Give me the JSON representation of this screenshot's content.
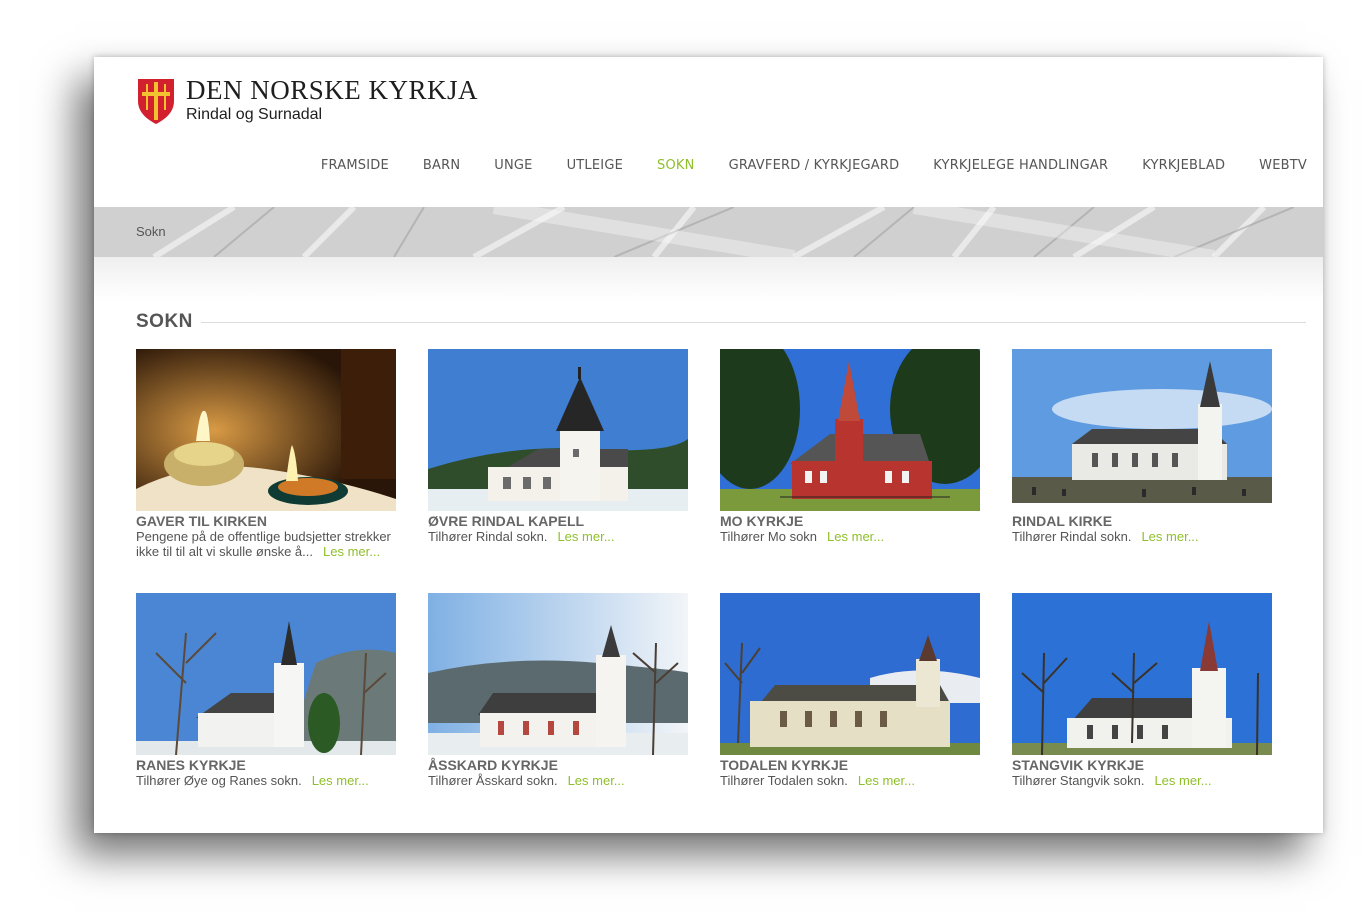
{
  "header": {
    "logo_title": "DEN NORSKE KYRKJA",
    "logo_subtitle": "Rindal og Surnadal",
    "nav": [
      {
        "label": "FRAMSIDE",
        "active": false
      },
      {
        "label": "BARN",
        "active": false
      },
      {
        "label": "UNGE",
        "active": false
      },
      {
        "label": "UTLEIGE",
        "active": false
      },
      {
        "label": "SOKN",
        "active": true
      },
      {
        "label": "GRAVFERD / KYRKJEGARD",
        "active": false
      },
      {
        "label": "KYRKJELEGE HANDLINGAR",
        "active": false
      },
      {
        "label": "KYRKJEBLAD",
        "active": false
      },
      {
        "label": "WEBTV",
        "active": false
      }
    ]
  },
  "breadcrumb": {
    "current": "Sokn"
  },
  "section": {
    "title": "SOKN"
  },
  "cards": [
    {
      "title": "GAVER TIL KIRKEN",
      "text_1": "Pengene på de offentlige budsjetter strekker",
      "text_2": "ikke til til alt vi skulle ønske å...",
      "more": "Les mer...",
      "image": "candles"
    },
    {
      "title": "ØVRE RINDAL KAPELL",
      "text_1": "Tilhører Rindal sokn.",
      "more": "Les mer...",
      "image": "white-chapel"
    },
    {
      "title": "MO KYRKJE",
      "text_1": "Tilhører Mo sokn",
      "more": "Les mer...",
      "image": "red-church"
    },
    {
      "title": "RINDAL KIRKE",
      "text_1": "Tilhører Rindal sokn.",
      "more": "Les mer...",
      "image": "white-church-cemetery"
    },
    {
      "title": "RANES KYRKJE",
      "text_1": "Tilhører Øye og Ranes sokn.",
      "more": "Les mer...",
      "image": "white-church-trees"
    },
    {
      "title": "ÅSSKARD KYRKJE",
      "text_1": "Tilhører Åsskard sokn.",
      "more": "Les mer...",
      "image": "white-church-winter"
    },
    {
      "title": "TODALEN KYRKJE",
      "text_1": "Tilhører Todalen sokn.",
      "more": "Les mer...",
      "image": "yellow-church"
    },
    {
      "title": "STANGVIK KYRKJE",
      "text_1": "Tilhører Stangvik sokn.",
      "more": "Les mer...",
      "image": "white-church-spring"
    }
  ],
  "colors": {
    "accent": "#8fbf2a",
    "text": "#555555",
    "shield_red": "#d2202f",
    "shield_gold": "#f2c230"
  }
}
